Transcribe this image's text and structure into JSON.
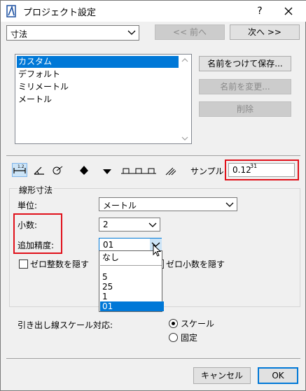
{
  "window": {
    "title": "プロジェクト設定",
    "help": "?"
  },
  "preset": {
    "selected": "寸法"
  },
  "nav": {
    "prev": "<< 前へ",
    "next": "次へ >>"
  },
  "presets": {
    "items": [
      "カスタム",
      "デフォルト",
      "ミリメートル",
      "メートル"
    ],
    "selected_index": 0
  },
  "actions": {
    "save_as": "名前をつけて保存...",
    "rename": "名前を変更...",
    "delete": "削除"
  },
  "toolbar": {
    "icon_names": [
      "linear-dimension-icon",
      "angle-dimension-icon",
      "radial-dimension-icon",
      "level-dimension-icon",
      "elevation-dimension-icon",
      "door-window-dimension-icon",
      "sill-height-dimension-icon",
      "area-calculation-icon"
    ],
    "sample_label": "サンプル:",
    "sample_value": "0.12",
    "sample_sup": "31"
  },
  "linear": {
    "group_title": "線形寸法",
    "unit_label": "単位:",
    "unit_value": "メートル",
    "decimals_label": "小数:",
    "decimals_value": "2",
    "extra_label": "追加精度:",
    "extra_value": "01",
    "hide_zero_int": "ゼロ整数を隠す",
    "hide_zero_dec": "ゼロ小数を隠す",
    "hide_zero_int_checked": false,
    "hide_zero_dec_checked": false
  },
  "extra_dropdown": {
    "options": [
      "なし",
      "5",
      "25",
      "1",
      "01"
    ],
    "selected_index": 4
  },
  "scale": {
    "label": "引き出し線スケール対応:",
    "option_scale": "スケール",
    "option_fixed": "固定",
    "selected": "スケール"
  },
  "footer": {
    "cancel": "キャンセル",
    "ok": "OK"
  },
  "colors": {
    "selection": "#0078d7",
    "highlight": "#e0101a",
    "dialog_bg": "#f0f0f0"
  }
}
